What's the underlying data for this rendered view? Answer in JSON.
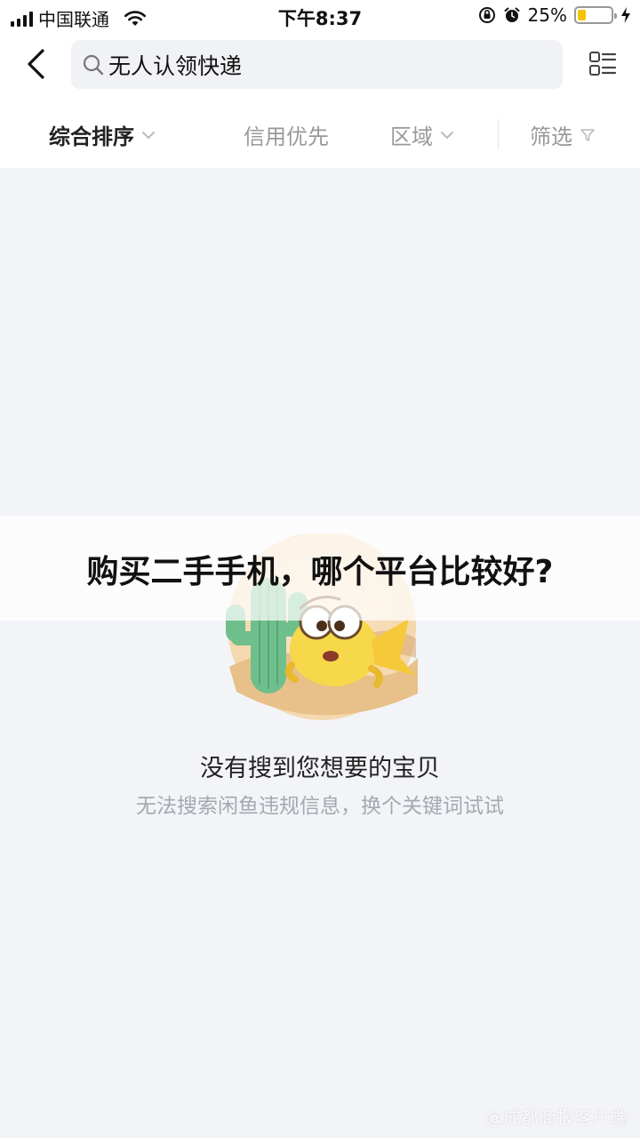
{
  "status_bar": {
    "carrier": "中国联通",
    "time": "下午8:37",
    "battery": "25%",
    "battery_level": 0.25
  },
  "search": {
    "query": "无人认领快递"
  },
  "filters": [
    {
      "label": "综合排序",
      "active": true,
      "icon": "chevron-down-icon"
    },
    {
      "label": "信用优先",
      "active": false
    },
    {
      "label": "区域",
      "active": false,
      "icon": "chevron-down-icon"
    },
    {
      "label": "筛选",
      "active": false,
      "icon": "filter-funnel-icon"
    }
  ],
  "empty_state": {
    "title": "没有搜到您想要的宝贝",
    "subtitle": "无法搜索闲鱼违规信息，换个关键词试试"
  },
  "overlay": {
    "title": "购买二手手机，哪个平台比较好?"
  },
  "watermark": "@成都商报客户端",
  "colors": {
    "background": "#f3f4f8",
    "battery_fill": "#f6c400",
    "muted_text": "#a5a8b0"
  }
}
